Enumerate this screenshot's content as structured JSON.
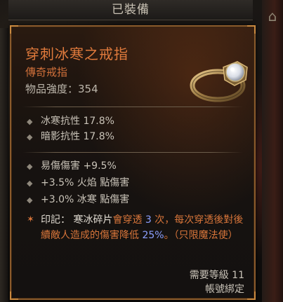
{
  "header": {
    "title": "已裝備"
  },
  "item": {
    "name": "穿刺冰寒之戒指",
    "type": "傳奇戒指",
    "power": "物品強度：354"
  },
  "implicit_stats": [
    "冰寒抗性 17.8%",
    "暗影抗性 17.8%"
  ],
  "affixes": [
    "易傷傷害 +9.5%",
    "+3.5% 火焰 點傷害",
    "+3.0% 冰寒 點傷害"
  ],
  "aspect": {
    "prefix": "印記：",
    "name": "寒冰碎片",
    "part1": "會穿透",
    "count": "3",
    "part2": "次，每次穿透後對後續敵人造成的傷害降低",
    "percent": "25%",
    "part3": "。（只限魔法使）"
  },
  "footer": {
    "required_level": "需要等級 11",
    "bound": "帳號綁定"
  },
  "icons": {
    "ring": "ring-icon",
    "bullet": "diamond-bullet-icon",
    "aspect": "star-icon"
  },
  "colors": {
    "legendary": "#e07a3c",
    "frame": "#8a5a2b",
    "highlight_blue": "#8ca0ff"
  }
}
